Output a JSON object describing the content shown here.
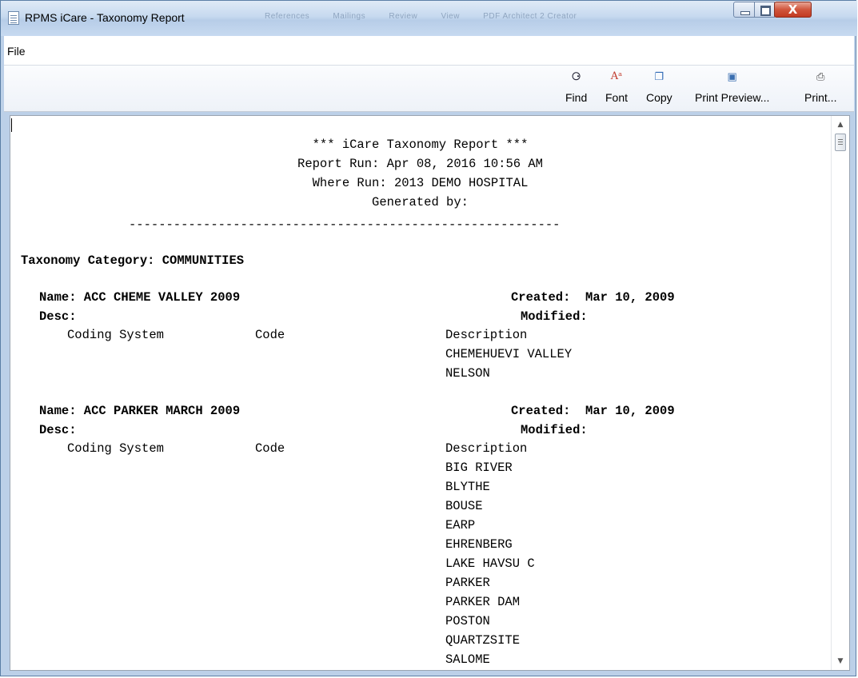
{
  "window": {
    "title": "RPMS iCare - Taxonomy Report",
    "background_tabs": [
      "References",
      "Mailings",
      "Review",
      "View",
      "PDF Architect 2 Creator"
    ],
    "close_label": "X"
  },
  "menu": {
    "file": "File"
  },
  "toolbar": {
    "find": {
      "label": "Find",
      "icon": "binoculars-icon"
    },
    "font": {
      "label": "Font",
      "icon": "font-icon"
    },
    "copy": {
      "label": "Copy",
      "icon": "copy-icon"
    },
    "print_preview": {
      "label": "Print Preview...",
      "icon": "print-preview-icon"
    },
    "print": {
      "label": "Print...",
      "icon": "printer-icon"
    }
  },
  "report": {
    "title": "*** iCare Taxonomy Report ***",
    "run": "Report Run: Apr 08, 2016 10:56 AM",
    "where": "Where Run: 2013 DEMO HOSPITAL",
    "generated": "Generated by:",
    "separator": "----------------------------------------------------------",
    "category": "Taxonomy Category: COMMUNITIES",
    "entries": [
      {
        "name": "Name: ACC CHEME VALLEY 2009",
        "created": "Created:  Mar 10, 2009",
        "desc": "Desc:",
        "modified": "Modified:",
        "col_system": "Coding System",
        "col_code": "Code",
        "col_desc": "Description",
        "items": [
          "CHEMEHUEVI VALLEY",
          "NELSON"
        ]
      },
      {
        "name": "Name: ACC PARKER MARCH 2009",
        "created": "Created:  Mar 10, 2009",
        "desc": "Desc:",
        "modified": "Modified:",
        "col_system": "Coding System",
        "col_code": "Code",
        "col_desc": "Description",
        "items": [
          "BIG RIVER",
          "BLYTHE",
          "BOUSE",
          "EARP",
          "EHRENBERG",
          "LAKE HAVSU C",
          "PARKER",
          "PARKER DAM",
          "POSTON",
          "QUARTZSITE",
          "SALOME"
        ]
      }
    ]
  }
}
